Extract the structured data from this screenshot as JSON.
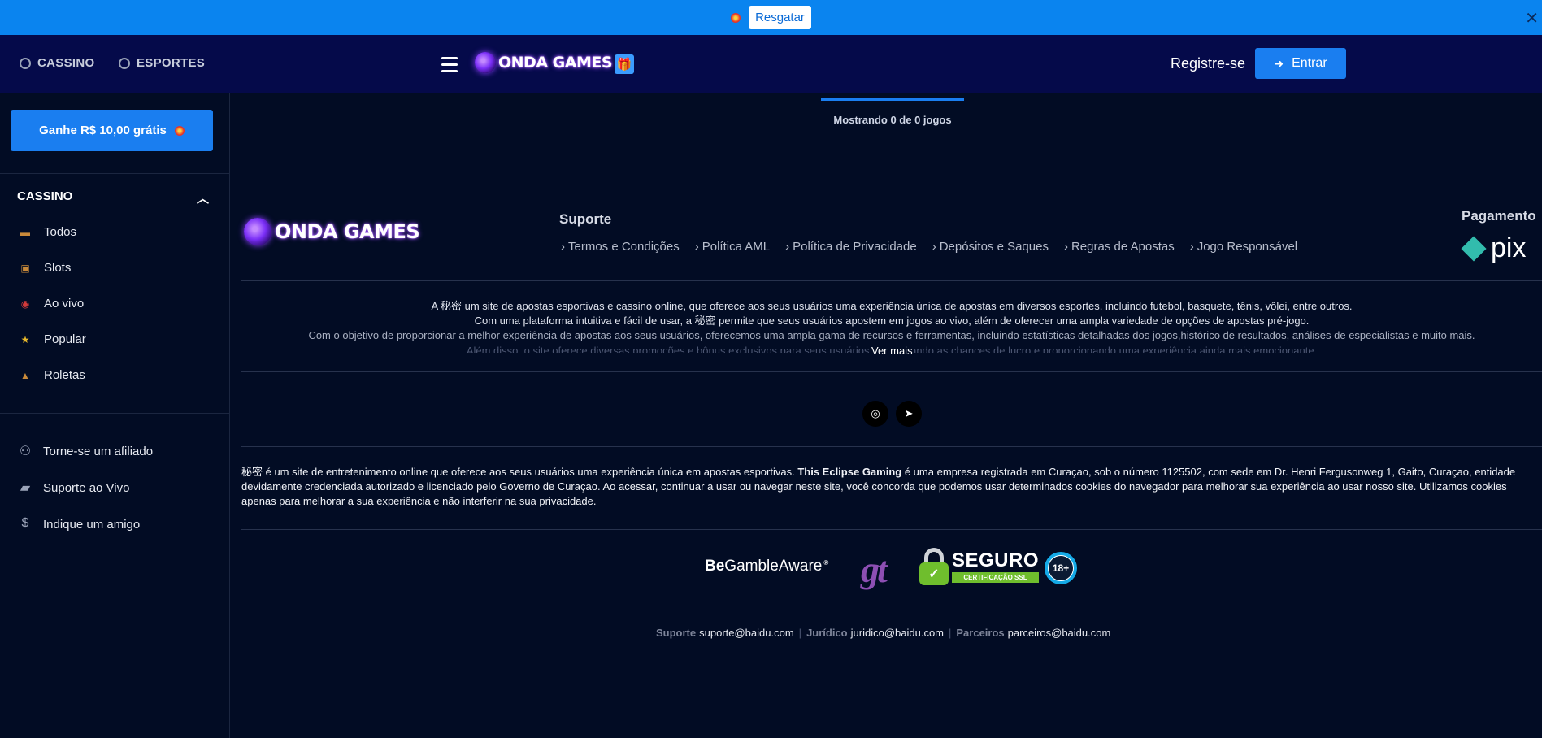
{
  "promo": {
    "redeem_label": "Resgatar",
    "close": "✕"
  },
  "header": {
    "nav": [
      {
        "label": "CASSINO",
        "icon": "casino-icon"
      },
      {
        "label": "ESPORTES",
        "icon": "soccer-ball-icon"
      }
    ],
    "logo_text": "ONDA GAMES",
    "register_label": "Registre-se",
    "login_label": "Entrar"
  },
  "sidebar": {
    "bonus_label": "Ganhe R$ 10,00 grátis",
    "category_title": "CASSINO",
    "categories": [
      {
        "label": "Todos",
        "icon": "treasure-chest-icon"
      },
      {
        "label": "Slots",
        "icon": "slot-machine-icon"
      },
      {
        "label": "Ao vivo",
        "icon": "live-icon"
      },
      {
        "label": "Popular",
        "icon": "star-icon"
      },
      {
        "label": "Roletas",
        "icon": "roulette-icon"
      }
    ],
    "extras": [
      {
        "label": "Torne-se um afiliado",
        "icon": "affiliate-icon"
      },
      {
        "label": "Suporte ao Vivo",
        "icon": "chat-icon"
      },
      {
        "label": "Indique um amigo",
        "icon": "money-bag-icon"
      }
    ]
  },
  "main": {
    "showing_text": "Mostrando 0 de 0 jogos"
  },
  "footer": {
    "logo_text": "ONDA GAMES",
    "support_title": "Suporte",
    "links": [
      "Termos e Condições",
      "Política AML",
      "Política de Privacidade",
      "Depósitos e Saques",
      "Regras de Apostas",
      "Jogo Responsável"
    ],
    "payment_title": "Pagamento",
    "payment_brand": "pix",
    "about": [
      "A 秘密 um site de apostas esportivas e cassino online, que oferece aos seus usuários uma experiência única de apostas em diversos esportes, incluindo futebol, basquete, tênis, vôlei, entre outros.",
      "Com uma plataforma intuitiva e fácil de usar, a 秘密 permite que seus usuários apostem em jogos ao vivo, além de oferecer uma ampla variedade de opções de apostas pré-jogo.",
      "Com o objetivo de proporcionar a melhor experiência de apostas aos seus usuários, oferecemos uma ampla gama de recursos e ferramentas, incluindo estatísticas detalhadas dos jogos,histórico de resultados, análises de especialistas e muito mais.",
      "Além disso, o site oferece diversas promoções e bônus exclusivos para seus usuários, aumentando as chances de lucro e proporcionando uma experiência ainda mais emocionante."
    ],
    "see_more": "Ver mais",
    "legal_prefix": "秘密 é um site de entretenimento online que oferece aos seus usuários uma experiência única em apostas esportivas.",
    "legal_company": "This Eclipse Gaming",
    "legal_rest": "é uma empresa registrada em Curaçao, sob o número 1125502, com sede em Dr. Henri Fergusonweg 1, Gaito, Curaçao, entidade devidamente credenciada autorizado e licenciado pelo Governo de Curaçao. Ao acessar, continuar a usar ou navegar neste site, você concorda que podemos usar determinados cookies do navegador para melhorar sua experiência ao usar nosso site. Utilizamos cookies apenas para melhorar a sua experiência e não interferir na sua privacidade.",
    "badges": {
      "begamble_be": "Be",
      "begamble_rest": "GambleAware",
      "begamble_reg": "®",
      "gt": "gt",
      "seguro": "SEGURO",
      "seguro_sub": "CERTIFICAÇÃO SSL",
      "age": "18+"
    },
    "contacts": [
      {
        "label": "Suporte",
        "email": "suporte@baidu.com"
      },
      {
        "label": "Jurídico",
        "email": "juridico@baidu.com"
      },
      {
        "label": "Parceiros",
        "email": "parceiros@baidu.com"
      }
    ],
    "separator": "|"
  },
  "colors": {
    "accent": "#1a7ef0",
    "promo_bar": "#0a84ef",
    "header_bg": "#050a4a",
    "page_bg": "#020c24"
  }
}
